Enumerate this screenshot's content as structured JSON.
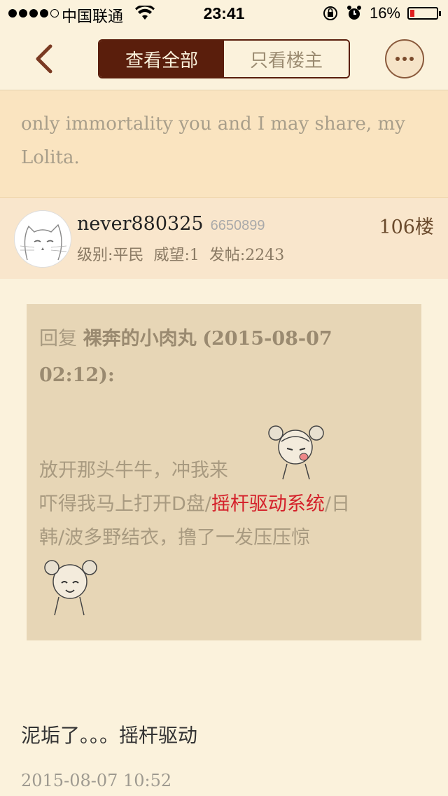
{
  "status_bar": {
    "carrier": "中国联通",
    "time": "23:41",
    "battery": "16%",
    "battery_level": 0.16
  },
  "nav": {
    "tab_all": "查看全部",
    "tab_op": "只看楼主"
  },
  "prev_post": {
    "text_line1": "only immortality you and I may share, my",
    "text_line2": "Lolita."
  },
  "post": {
    "username": "never880325",
    "user_id": "6650899",
    "level_label": "级别:",
    "level_value": "平民",
    "prestige_label": "威望:",
    "prestige_value": "1",
    "posts_label": "发帖:",
    "posts_value": "2243",
    "floor": "106楼",
    "quote": {
      "reply_prefix": "回复",
      "reply_user": "裸奔的小肉丸",
      "reply_time": "(2015-08-07 02:12):",
      "line1": "放开那头牛牛，冲我来",
      "line2_a": "吓得我马上打开D盘/",
      "line2_red": "摇杆驱动系统",
      "line2_b": "/日",
      "line3": "韩/波多野结衣，撸了一发压压惊"
    },
    "content": "泥垢了。。。摇杆驱动",
    "date": "2015-08-07 10:52"
  },
  "colors": {
    "accent": "#5a1e0c",
    "background": "#fbf2dc",
    "highlight": "#d4202a"
  }
}
